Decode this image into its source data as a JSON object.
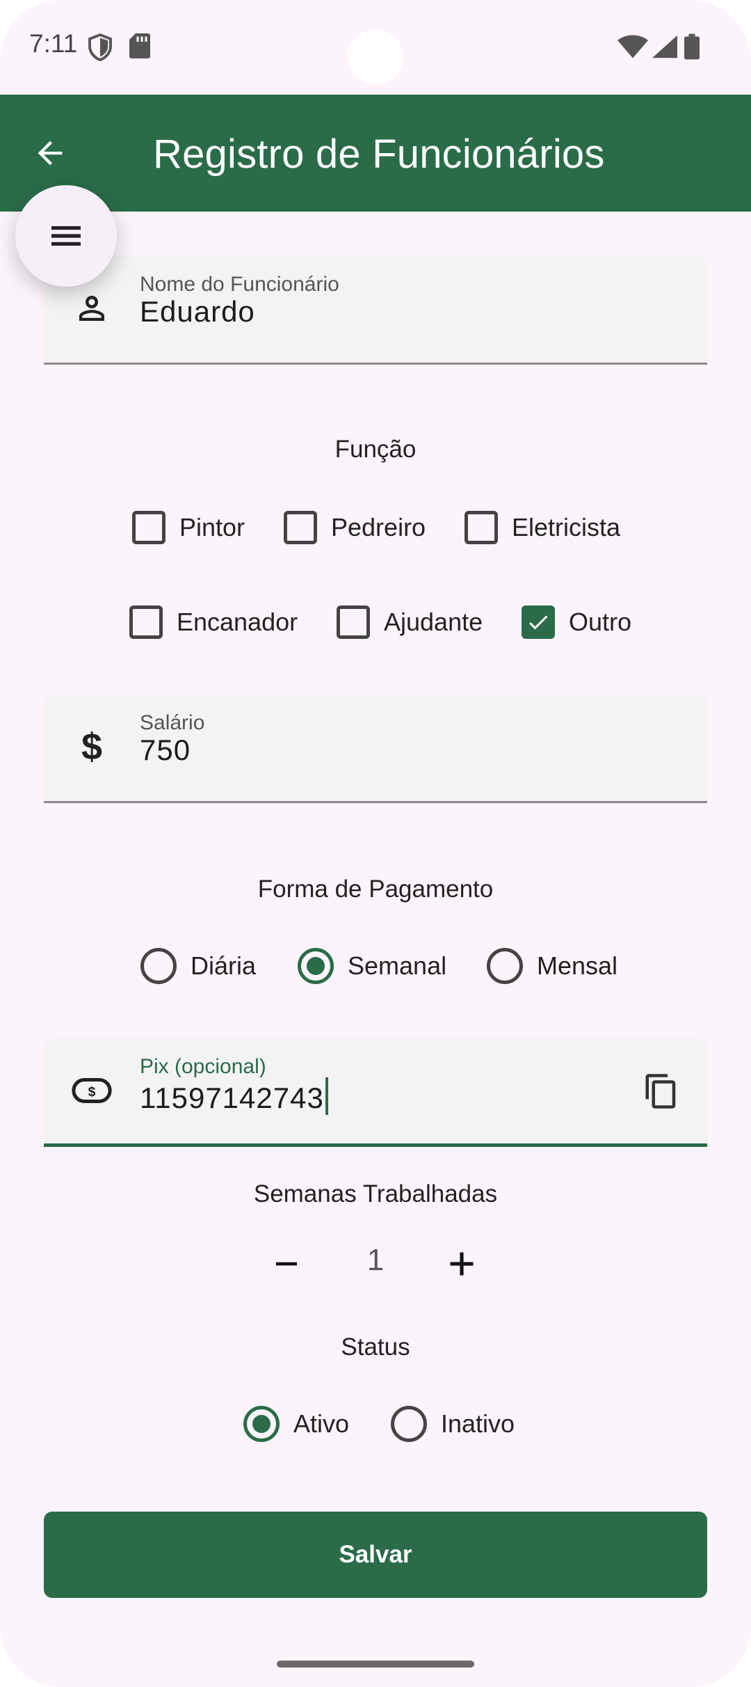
{
  "status_bar": {
    "time": "7:11"
  },
  "app_bar": {
    "title": "Registro de Funcionários"
  },
  "name_field": {
    "label": "Nome do Funcionário",
    "value": "Eduardo",
    "icon": "person-icon"
  },
  "funcao": {
    "title": "Função",
    "options": [
      {
        "label": "Pintor",
        "checked": false
      },
      {
        "label": "Pedreiro",
        "checked": false
      },
      {
        "label": "Eletricista",
        "checked": false
      },
      {
        "label": "Encanador",
        "checked": false
      },
      {
        "label": "Ajudante",
        "checked": false
      },
      {
        "label": "Outro",
        "checked": true
      }
    ]
  },
  "salario_field": {
    "label": "Salário",
    "value": "750",
    "icon": "dollar-icon"
  },
  "pagamento": {
    "title": "Forma de Pagamento",
    "options": [
      {
        "label": "Diária",
        "selected": false
      },
      {
        "label": "Semanal",
        "selected": true
      },
      {
        "label": "Mensal",
        "selected": false
      }
    ]
  },
  "pix_field": {
    "label": "Pix (opcional)",
    "value": "11597142743",
    "icon": "payments-icon",
    "trailing_icon": "copy-icon"
  },
  "semanas": {
    "title": "Semanas Trabalhadas",
    "value": "1"
  },
  "status": {
    "title": "Status",
    "options": [
      {
        "label": "Ativo",
        "selected": true
      },
      {
        "label": "Inativo",
        "selected": false
      }
    ]
  },
  "save_button": {
    "label": "Salvar"
  },
  "colors": {
    "primary": "#2a6b48",
    "background": "#fcf4fb",
    "field_bg": "#f3f3f3"
  }
}
